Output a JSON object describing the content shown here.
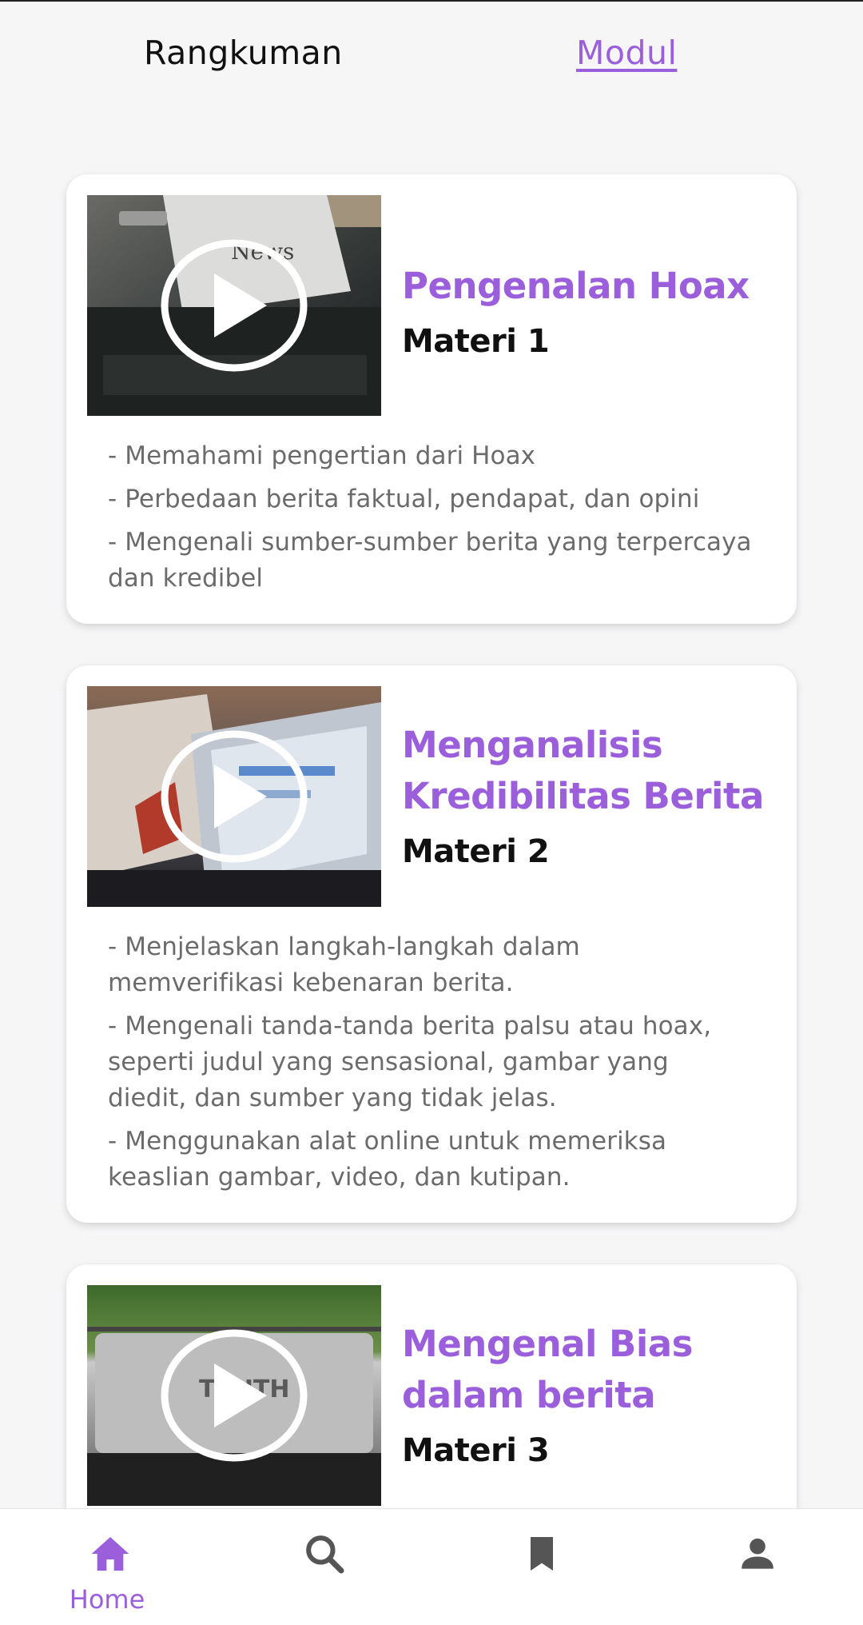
{
  "tabs": {
    "rangkuman": "Rangkuman",
    "modul": "Modul"
  },
  "colors": {
    "accent": "#9b5fdc",
    "nav_inactive": "#555555"
  },
  "modules": [
    {
      "title": "Pengenalan Hoax",
      "subtitle": "Materi 1",
      "thumbnail_icon": "play-icon",
      "points": [
        "- Memahami pengertian dari Hoax",
        "- Perbedaan berita faktual, pendapat, dan opini",
        "- Mengenali sumber-sumber berita yang terpercaya dan kredibel"
      ]
    },
    {
      "title": "Menganalisis Kredibilitas Berita",
      "subtitle": "Materi 2",
      "thumbnail_icon": "play-icon",
      "points": [
        "- Menjelaskan langkah-langkah dalam memverifikasi kebenaran berita.",
        "- Mengenali tanda-tanda berita palsu atau hoax, seperti judul yang sensasional, gambar yang diedit, dan sumber yang tidak jelas.",
        "- Menggunakan alat online untuk memeriksa keaslian gambar, video, dan kutipan."
      ]
    },
    {
      "title": "Mengenal Bias dalam berita",
      "subtitle": "Materi 3",
      "thumbnail_icon": "play-icon",
      "points": []
    }
  ],
  "bottom_nav": {
    "items": [
      {
        "label": "Home",
        "icon": "home-icon",
        "active": true
      },
      {
        "label": "",
        "icon": "search-icon",
        "active": false
      },
      {
        "label": "",
        "icon": "bookmark-icon",
        "active": false
      },
      {
        "label": "",
        "icon": "profile-icon",
        "active": false
      }
    ]
  }
}
